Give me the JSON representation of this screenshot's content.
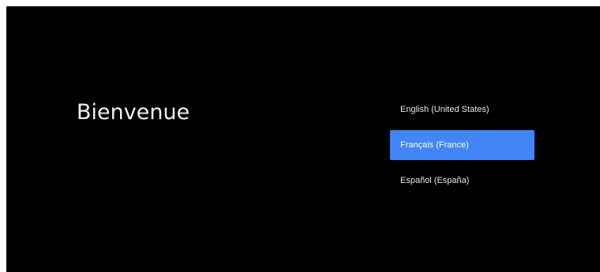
{
  "welcome": {
    "title": "Bienvenue"
  },
  "languages": {
    "selected_index": 1,
    "accent_color": "#4285f4",
    "items": [
      {
        "label": "English (United States)"
      },
      {
        "label": "Français (France)"
      },
      {
        "label": "Español (España)"
      }
    ]
  }
}
